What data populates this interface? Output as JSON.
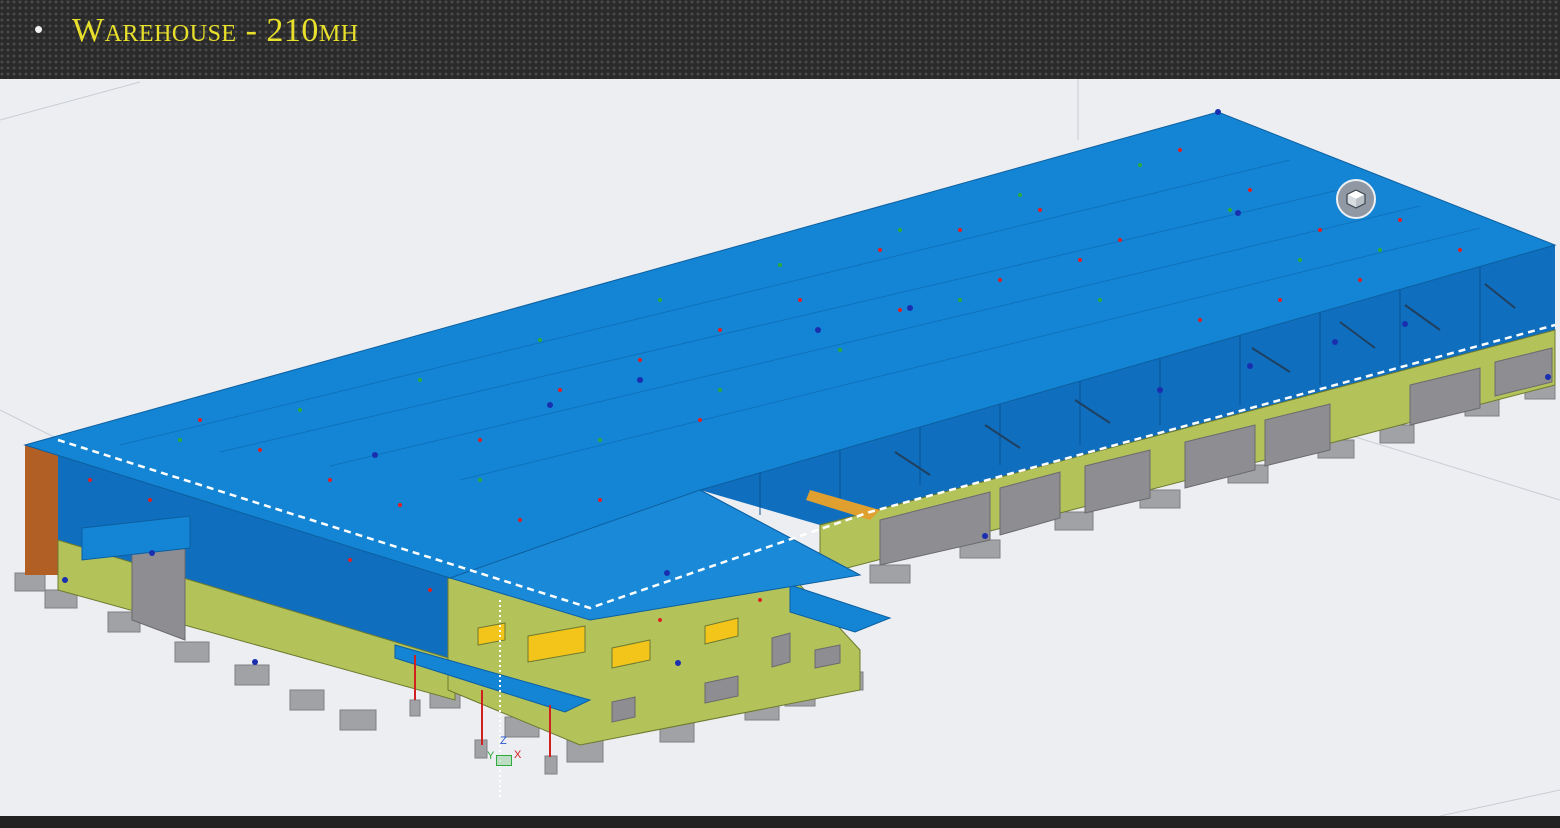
{
  "slide": {
    "bullet": "•",
    "title": "Warehouse - 210mh"
  },
  "viewport": {
    "background": "#eceef2",
    "view_cube_icon": "cube-icon"
  },
  "axis_triad": {
    "z_label": "Z",
    "x_label": "X",
    "y_label": "Y"
  },
  "colors": {
    "roof": "#1485d4",
    "wall_dark": "#0f6ebd",
    "concrete": "#b4c25a",
    "opening": "#8d8d92",
    "footing": "#a0a2a6",
    "accent_title": "#e8e02a",
    "end_wall": "#b25f25"
  }
}
